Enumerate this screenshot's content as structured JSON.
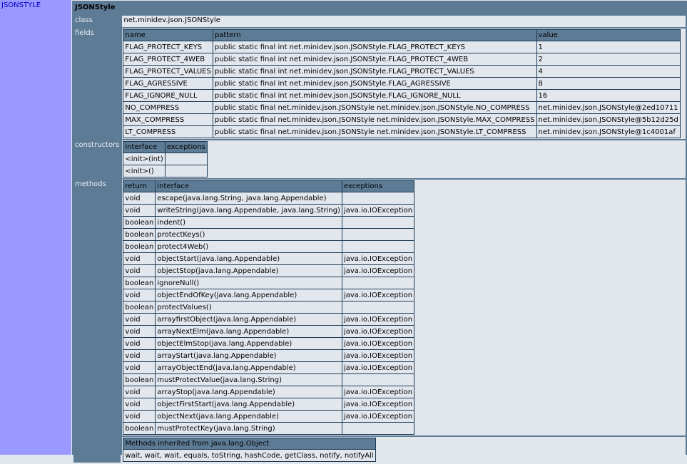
{
  "sidebar": {
    "title": "JSONSTYLE"
  },
  "section": {
    "title": "JSONStyle",
    "class_label": "class",
    "class_value": "net.minidev.json.JSONStyle",
    "fields_label": "fields",
    "constructors_label": "constructors",
    "methods_label": "methods"
  },
  "fields": {
    "headers": [
      "name",
      "pattern",
      "value"
    ],
    "rows": [
      [
        "FLAG_PROTECT_KEYS",
        "public static final int net.minidev.json.JSONStyle.FLAG_PROTECT_KEYS",
        "1"
      ],
      [
        "FLAG_PROTECT_4WEB",
        "public static final int net.minidev.json.JSONStyle.FLAG_PROTECT_4WEB",
        "2"
      ],
      [
        "FLAG_PROTECT_VALUES",
        "public static final int net.minidev.json.JSONStyle.FLAG_PROTECT_VALUES",
        "4"
      ],
      [
        "FLAG_AGRESSIVE",
        "public static final int net.minidev.json.JSONStyle.FLAG_AGRESSIVE",
        "8"
      ],
      [
        "FLAG_IGNORE_NULL",
        "public static final int net.minidev.json.JSONStyle.FLAG_IGNORE_NULL",
        "16"
      ],
      [
        "NO_COMPRESS",
        "public static final net.minidev.json.JSONStyle net.minidev.json.JSONStyle.NO_COMPRESS",
        "net.minidev.json.JSONStyle@2ed10711"
      ],
      [
        "MAX_COMPRESS",
        "public static final net.minidev.json.JSONStyle net.minidev.json.JSONStyle.MAX_COMPRESS",
        "net.minidev.json.JSONStyle@5b12d25d"
      ],
      [
        "LT_COMPRESS",
        "public static final net.minidev.json.JSONStyle net.minidev.json.JSONStyle.LT_COMPRESS",
        "net.minidev.json.JSONStyle@1c4001af"
      ]
    ]
  },
  "constructors": {
    "headers": [
      "interface",
      "exceptions"
    ],
    "rows": [
      [
        "<init>(int)",
        ""
      ],
      [
        "<init>()",
        ""
      ]
    ]
  },
  "methods": {
    "headers": [
      "return",
      "interface",
      "exceptions"
    ],
    "rows": [
      [
        "void",
        "escape(java.lang.String, java.lang.Appendable)",
        ""
      ],
      [
        "void",
        "writeString(java.lang.Appendable, java.lang.String)",
        "java.io.IOException"
      ],
      [
        "boolean",
        "indent()",
        ""
      ],
      [
        "boolean",
        "protectKeys()",
        ""
      ],
      [
        "boolean",
        "protect4Web()",
        ""
      ],
      [
        "void",
        "objectStart(java.lang.Appendable)",
        "java.io.IOException"
      ],
      [
        "void",
        "objectStop(java.lang.Appendable)",
        "java.io.IOException"
      ],
      [
        "boolean",
        "ignoreNull()",
        ""
      ],
      [
        "void",
        "objectEndOfKey(java.lang.Appendable)",
        "java.io.IOException"
      ],
      [
        "boolean",
        "protectValues()",
        ""
      ],
      [
        "void",
        "arrayfirstObject(java.lang.Appendable)",
        "java.io.IOException"
      ],
      [
        "void",
        "arrayNextElm(java.lang.Appendable)",
        "java.io.IOException"
      ],
      [
        "void",
        "objectElmStop(java.lang.Appendable)",
        "java.io.IOException"
      ],
      [
        "void",
        "arrayStart(java.lang.Appendable)",
        "java.io.IOException"
      ],
      [
        "void",
        "arrayObjectEnd(java.lang.Appendable)",
        "java.io.IOException"
      ],
      [
        "boolean",
        "mustProtectValue(java.lang.String)",
        ""
      ],
      [
        "void",
        "arrayStop(java.lang.Appendable)",
        "java.io.IOException"
      ],
      [
        "void",
        "objectFirstStart(java.lang.Appendable)",
        "java.io.IOException"
      ],
      [
        "void",
        "objectNext(java.lang.Appendable)",
        "java.io.IOException"
      ],
      [
        "boolean",
        "mustProtectKey(java.lang.String)",
        ""
      ]
    ]
  },
  "inherited": {
    "header": "Methods inherited from java.lang.Object",
    "value": "wait, wait, wait, equals, toString, hashCode, getClass, notify, notifyAll"
  },
  "colors": {
    "sidebar": "#9999ff",
    "sidebar_text": "#0000cc",
    "header_bg": "#5d7b95",
    "cell_bg": "#e2e7ee",
    "border": "#1e3a55"
  }
}
